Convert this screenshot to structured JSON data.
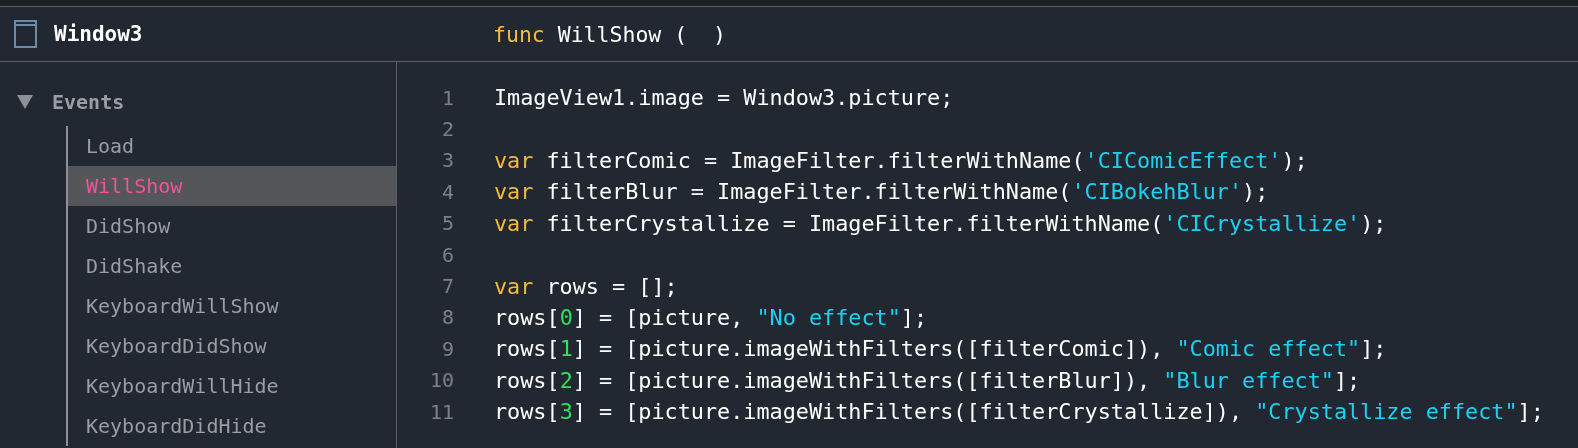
{
  "header": {
    "title": "Window3",
    "signature": {
      "keyword": "func",
      "name": "WillShow",
      "params": "(  )"
    }
  },
  "sidebar": {
    "groups": [
      {
        "label": "Events",
        "expanded": true,
        "children": [
          {
            "label": "Load",
            "selected": false
          },
          {
            "label": "WillShow",
            "selected": true
          },
          {
            "label": "DidShow",
            "selected": false
          },
          {
            "label": "DidShake",
            "selected": false
          },
          {
            "label": "KeyboardWillShow",
            "selected": false
          },
          {
            "label": "KeyboardDidShow",
            "selected": false
          },
          {
            "label": "KeyboardWillHide",
            "selected": false
          },
          {
            "label": "KeyboardDidHide",
            "selected": false
          }
        ]
      }
    ]
  },
  "editor": {
    "lines": [
      {
        "number": "1",
        "tokens": [
          {
            "kind": "plain",
            "text": "ImageView1.image = Window3.picture;"
          }
        ]
      },
      {
        "number": "2"
      },
      {
        "number": "3",
        "tokens": [
          {
            "kind": "keyword",
            "text": "var"
          },
          {
            "kind": "plain",
            "text": " filterComic = ImageFilter.filterWithName("
          },
          {
            "kind": "string",
            "text": "'CIComicEffect'"
          },
          {
            "kind": "plain",
            "text": ");"
          }
        ]
      },
      {
        "number": "4",
        "tokens": [
          {
            "kind": "keyword",
            "text": "var"
          },
          {
            "kind": "plain",
            "text": " filterBlur = ImageFilter.filterWithName("
          },
          {
            "kind": "string",
            "text": "'CIBokehBlur'"
          },
          {
            "kind": "plain",
            "text": ");"
          }
        ]
      },
      {
        "number": "5",
        "tokens": [
          {
            "kind": "keyword",
            "text": "var"
          },
          {
            "kind": "plain",
            "text": " filterCrystallize = ImageFilter.filterWithName("
          },
          {
            "kind": "string",
            "text": "'CICrystallize'"
          },
          {
            "kind": "plain",
            "text": ");"
          }
        ]
      },
      {
        "number": "6"
      },
      {
        "number": "7",
        "tokens": [
          {
            "kind": "keyword",
            "text": "var"
          },
          {
            "kind": "plain",
            "text": " rows = [];"
          }
        ]
      },
      {
        "number": "8",
        "tokens": [
          {
            "kind": "plain",
            "text": "rows["
          },
          {
            "kind": "number",
            "text": "0"
          },
          {
            "kind": "plain",
            "text": "] = [picture, "
          },
          {
            "kind": "string",
            "text": "\"No effect\""
          },
          {
            "kind": "plain",
            "text": "];"
          }
        ]
      },
      {
        "number": "9",
        "tokens": [
          {
            "kind": "plain",
            "text": "rows["
          },
          {
            "kind": "number",
            "text": "1"
          },
          {
            "kind": "plain",
            "text": "] = [picture.imageWithFilters([filterComic]), "
          },
          {
            "kind": "string",
            "text": "\"Comic effect\""
          },
          {
            "kind": "plain",
            "text": "];"
          }
        ]
      },
      {
        "number": "10",
        "tokens": [
          {
            "kind": "plain",
            "text": "rows["
          },
          {
            "kind": "number",
            "text": "2"
          },
          {
            "kind": "plain",
            "text": "] = [picture.imageWithFilters([filterBlur]), "
          },
          {
            "kind": "string",
            "text": "\"Blur effect\""
          },
          {
            "kind": "plain",
            "text": "];"
          }
        ]
      },
      {
        "number": "11",
        "tokens": [
          {
            "kind": "plain",
            "text": "rows["
          },
          {
            "kind": "number",
            "text": "3"
          },
          {
            "kind": "plain",
            "text": "] = [picture.imageWithFilters([filterCrystallize]), "
          },
          {
            "kind": "string",
            "text": "\"Crystallize effect\""
          },
          {
            "kind": "plain",
            "text": "];"
          }
        ]
      }
    ]
  }
}
